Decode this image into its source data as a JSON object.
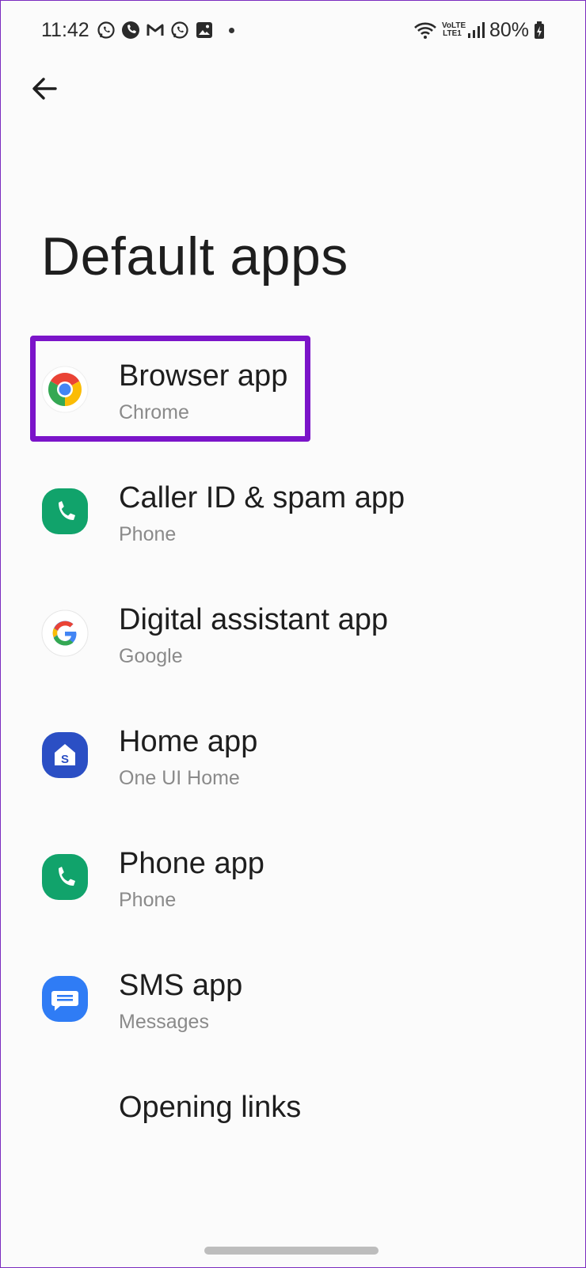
{
  "status_bar": {
    "time": "11:42",
    "notification_icons": [
      "whatsapp-icon",
      "phone-call-icon",
      "gmail-icon",
      "whatsapp-icon",
      "gallery-icon"
    ],
    "network": "VoLTE LTE1",
    "battery": "80%"
  },
  "page": {
    "title": "Default apps"
  },
  "items": [
    {
      "label": "Browser app",
      "sub": "Chrome",
      "icon": "chrome-icon"
    },
    {
      "label": "Caller ID & spam app",
      "sub": "Phone",
      "icon": "phone-app-icon"
    },
    {
      "label": "Digital assistant app",
      "sub": "Google",
      "icon": "google-icon"
    },
    {
      "label": "Home app",
      "sub": "One UI Home",
      "icon": "one-ui-home-icon"
    },
    {
      "label": "Phone app",
      "sub": "Phone",
      "icon": "phone-app-icon"
    },
    {
      "label": "SMS app",
      "sub": "Messages",
      "icon": "messages-icon"
    },
    {
      "label": "Opening links",
      "sub": "",
      "icon": ""
    }
  ],
  "colors": {
    "highlight": "#7b14c9",
    "phone_green": "#11a36b",
    "home_blue": "#2b4fc4",
    "messages_blue": "#2f7cf5"
  }
}
